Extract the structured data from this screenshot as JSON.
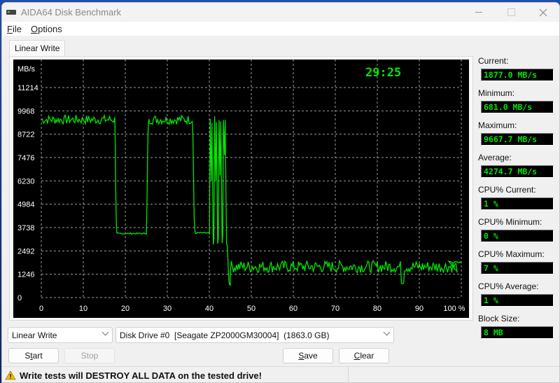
{
  "window": {
    "title": "AIDA64 Disk Benchmark",
    "icon": "disk-drive-icon",
    "controls": [
      "minimize-icon",
      "maximize-icon",
      "close-icon"
    ]
  },
  "menu": {
    "items": [
      {
        "label_first": "F",
        "label_rest": "ile"
      },
      {
        "label_first": "O",
        "label_rest": "ptions"
      }
    ]
  },
  "tabs": [
    {
      "label": "Linear Write",
      "active": true
    }
  ],
  "timer": "29:25",
  "stats": [
    {
      "label": "Current:",
      "value": "1877.0 MB/s"
    },
    {
      "label": "Minimum:",
      "value": "681.0 MB/s"
    },
    {
      "label": "Maximum:",
      "value": "9667.7 MB/s"
    },
    {
      "label": "Average:",
      "value": "4274.7 MB/s"
    },
    {
      "label": "CPU% Current:",
      "value": "1 %"
    },
    {
      "label": "CPU% Minimum:",
      "value": "0 %"
    },
    {
      "label": "CPU% Maximum:",
      "value": "7 %"
    },
    {
      "label": "CPU% Average:",
      "value": "1 %"
    },
    {
      "label": "Block Size:",
      "value": "8 MB"
    }
  ],
  "controls": {
    "test_select": {
      "value": "Linear Write"
    },
    "drive_select": {
      "value": "Disk Drive #0  [Seagate ZP2000GM30004]  (1863.0 GB)"
    },
    "start": {
      "pre": "S",
      "ul": "t",
      "post": "art",
      "enabled": true
    },
    "stop": {
      "label": "Stop",
      "enabled": false
    },
    "save": {
      "pre": "",
      "ul": "S",
      "post": "ave",
      "enabled": true
    },
    "clear": {
      "pre": "",
      "ul": "C",
      "post": "lear",
      "enabled": true
    }
  },
  "status": {
    "icon": "warning-icon",
    "text": "Write tests will DESTROY ALL DATA on the tested drive!"
  },
  "colors": {
    "line": "#00e600",
    "grid": "#9a9a9a",
    "chart_bg": "#000000",
    "text": "#ffffff"
  },
  "chart_data": {
    "type": "line",
    "title": "",
    "ylabel": "MB/s",
    "xlabel": "",
    "xlim": [
      0,
      100
    ],
    "ylim": [
      0,
      11214
    ],
    "grid": true,
    "x_ticks": [
      0,
      10,
      20,
      30,
      40,
      50,
      60,
      70,
      80,
      90,
      100
    ],
    "x_tick_labels": [
      "0",
      "10",
      "20",
      "30",
      "40",
      "50",
      "60",
      "70",
      "80",
      "90",
      "100 %"
    ],
    "y_ticks": [
      0,
      1246,
      2492,
      3738,
      4984,
      6230,
      7476,
      8722,
      9968,
      11214
    ],
    "y_tick_labels": [
      "0",
      "1246",
      "2492",
      "3738",
      "4984",
      "6230",
      "7476",
      "8722",
      "9968",
      "11214"
    ],
    "segments": [
      {
        "x_start": 0,
        "x_end": 17.5,
        "level": 9500,
        "noise": 250
      },
      {
        "x_start": 17.5,
        "x_end": 18.0,
        "ramp_to": 3450
      },
      {
        "x_start": 18.0,
        "x_end": 25.0,
        "level": 3420,
        "noise": 40
      },
      {
        "x_start": 25.0,
        "x_end": 25.7,
        "ramp_to": 9500
      },
      {
        "x_start": 25.7,
        "x_end": 36.0,
        "level": 9500,
        "noise": 250
      },
      {
        "x_start": 36.0,
        "x_end": 36.7,
        "ramp_to": 3450
      },
      {
        "x_start": 36.7,
        "x_end": 40.0,
        "level": 3450,
        "noise": 40
      },
      {
        "x_start": 40.0,
        "x_end": 44.2,
        "oscillating": true,
        "low": 3000,
        "high": 9700,
        "cycles": 4
      },
      {
        "x_start": 44.2,
        "x_end": 45.0,
        "ramp_to": 681
      },
      {
        "x_start": 45.0,
        "x_end": 99.0,
        "level": 1650,
        "noise": 320,
        "dip_at": 86,
        "dip_value": 750
      },
      {
        "x_start": 97.0,
        "x_end": 100.0,
        "level": 1877,
        "noise": 60
      }
    ]
  }
}
